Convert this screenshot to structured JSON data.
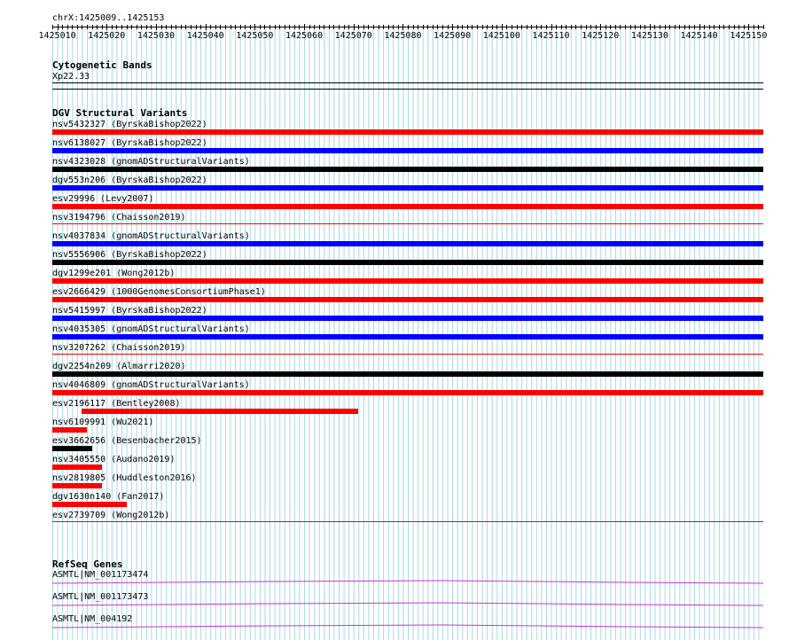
{
  "region": "chrX:1425009..1425153",
  "ruler": {
    "start": 1425009,
    "end": 1425153,
    "labels": [
      "1425010",
      "1425020",
      "1425030",
      "1425040",
      "1425050",
      "1425060",
      "1425070",
      "1425080",
      "1425090",
      "1425100",
      "1425110",
      "1425120",
      "1425130",
      "1425140",
      "1425150"
    ]
  },
  "cytoband": {
    "title": "Cytogenetic Bands",
    "band": "Xp22.33"
  },
  "dgv": {
    "title": "DGV Structural Variants",
    "variants": [
      {
        "label": "nsv5432327 (ByrskaBishop2022)",
        "color": "#ff0000",
        "start": 1425009,
        "end": 1425153
      },
      {
        "label": "nsv6138027 (ByrskaBishop2022)",
        "color": "#0000ff",
        "start": 1425009,
        "end": 1425153
      },
      {
        "label": "nsv4323028 (gnomADStructuralVariants)",
        "color": "#000000",
        "start": 1425009,
        "end": 1425153
      },
      {
        "label": "dgv553n206 (ByrskaBishop2022)",
        "color": "#0000ff",
        "start": 1425009,
        "end": 1425153
      },
      {
        "label": "esv29996 (Levy2007)",
        "color": "#ff0000",
        "start": 1425009,
        "end": 1425153
      },
      {
        "label": "nsv3194796 (Chaisson2019)",
        "color": "#ff0000",
        "start": 1425009,
        "end": 1425153,
        "thin": true
      },
      {
        "label": "nsv4037834 (gnomADStructuralVariants)",
        "color": "#0000ff",
        "start": 1425009,
        "end": 1425153
      },
      {
        "label": "nsv5556906 (ByrskaBishop2022)",
        "color": "#000000",
        "start": 1425009,
        "end": 1425153
      },
      {
        "label": "dgv1299e201 (Wong2012b)",
        "color": "#ff0000",
        "start": 1425009,
        "end": 1425153
      },
      {
        "label": "esv2666429 (1000GenomesConsortiumPhase1)",
        "color": "#ff0000",
        "start": 1425009,
        "end": 1425153
      },
      {
        "label": "nsv5415997 (ByrskaBishop2022)",
        "color": "#0000ff",
        "start": 1425009,
        "end": 1425153
      },
      {
        "label": "nsv4035305 (gnomADStructuralVariants)",
        "color": "#0000ff",
        "start": 1425009,
        "end": 1425153
      },
      {
        "label": "nsv3207262 (Chaisson2019)",
        "color": "#ff0000",
        "start": 1425009,
        "end": 1425153,
        "thin": true
      },
      {
        "label": "dgv2254n209 (Almarri2020)",
        "color": "#000000",
        "start": 1425009,
        "end": 1425153
      },
      {
        "label": "nsv4046809 (gnomADStructuralVariants)",
        "color": "#ff0000",
        "start": 1425009,
        "end": 1425153
      },
      {
        "label": "esv2196117 (Bentley2008)",
        "color": "#ff0000",
        "start": 1425015,
        "end": 1425071
      },
      {
        "label": "nsv6109991 (Wu2021)",
        "color": "#ff0000",
        "start": 1425009,
        "end": 1425016
      },
      {
        "label": "esv3662656 (Besenbacher2015)",
        "color": "#000000",
        "start": 1425009,
        "end": 1425017
      },
      {
        "label": "nsv3405550 (Audano2019)",
        "color": "#ff0000",
        "start": 1425009,
        "end": 1425019
      },
      {
        "label": "nsv2819805 (Huddleston2016)",
        "color": "#ff0000",
        "start": 1425009,
        "end": 1425019
      },
      {
        "label": "dgv1630n140 (Fan2017)",
        "color": "#ff0000",
        "start": 1425009,
        "end": 1425024
      },
      {
        "label": "esv2739709 (Wong2012b)",
        "color": "#ff0000",
        "start": 1425009,
        "end": 1425153,
        "thin": true
      }
    ]
  },
  "refseq": {
    "title": "RefSeq Genes",
    "genes": [
      {
        "label": "ASMTL|NM_001173474",
        "color": "#cc33cc"
      },
      {
        "label": "ASMTL|NM_001173473",
        "color": "#cc33cc"
      },
      {
        "label": "ASMTL|NM_004192",
        "color": "#cc33cc"
      }
    ]
  },
  "colors": {
    "grid": "#a8d8e8",
    "red": "#ff0000",
    "blue": "#0000ff",
    "black": "#000000",
    "refseq": "#cc33cc"
  }
}
